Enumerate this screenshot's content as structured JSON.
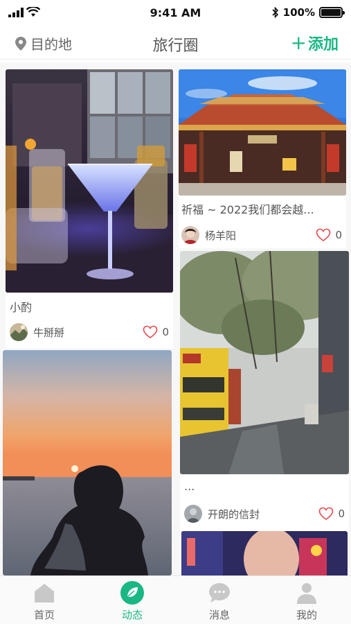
{
  "status_bar": {
    "time": "9:41 AM",
    "battery": "100%",
    "battery_level": 1.0
  },
  "nav": {
    "destination_label": "目的地",
    "title": "旅行圈",
    "add_label": "添加",
    "add_symbol": "+"
  },
  "posts": [
    {
      "title": "小酌",
      "author": "牛掰掰",
      "likes": "0"
    },
    {
      "title": "祈福 ~ 2022我们都会越...",
      "author": "杨羊阳",
      "likes": "0"
    },
    {
      "title": "",
      "author": "",
      "likes": ""
    },
    {
      "title": "...",
      "author": "开朗的信封",
      "likes": "0"
    },
    {
      "title": "",
      "author": "",
      "likes": ""
    }
  ],
  "tabs": [
    {
      "label": "首页",
      "icon": "home-icon",
      "active": false
    },
    {
      "label": "动态",
      "icon": "leaf-icon",
      "active": true
    },
    {
      "label": "消息",
      "icon": "message-icon",
      "active": false
    },
    {
      "label": "我的",
      "icon": "profile-icon",
      "active": false
    }
  ],
  "colors": {
    "accent": "#19b784",
    "heart": "#e5484d"
  }
}
